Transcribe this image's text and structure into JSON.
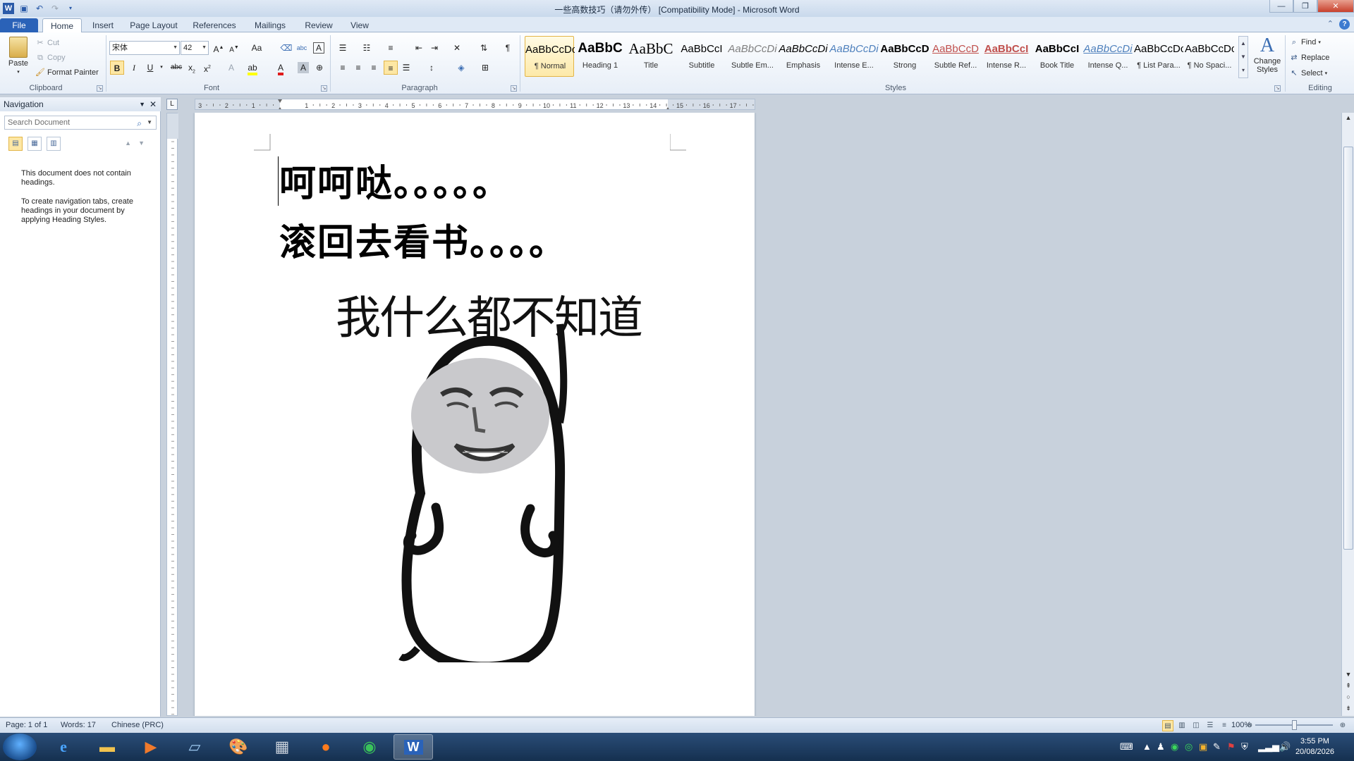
{
  "window": {
    "title": "一些高数技巧（请勿外传） [Compatibility Mode] - Microsoft Word"
  },
  "tabs": [
    "File",
    "Home",
    "Insert",
    "Page Layout",
    "References",
    "Mailings",
    "Review",
    "View"
  ],
  "clipboard": {
    "paste": "Paste",
    "cut": "Cut",
    "copy": "Copy",
    "format_painter": "Format Painter",
    "label": "Clipboard"
  },
  "font": {
    "name": "宋体",
    "size": "42",
    "label": "Font"
  },
  "paragraph": {
    "label": "Paragraph"
  },
  "styles": {
    "label": "Styles",
    "items": [
      {
        "sample": "AaBbCcDc",
        "name": "¶ Normal",
        "color": "#000000"
      },
      {
        "sample": "AaBbC",
        "name": "Heading 1",
        "color": "#000000"
      },
      {
        "sample": "AaBbC",
        "name": "Title",
        "color": "#000000"
      },
      {
        "sample": "AaBbCcI",
        "name": "Subtitle",
        "color": "#000000"
      },
      {
        "sample": "AaBbCcDi",
        "name": "Subtle Em...",
        "color": "#7f7f7f"
      },
      {
        "sample": "AaBbCcDi",
        "name": "Emphasis",
        "color": "#000000"
      },
      {
        "sample": "AaBbCcDi",
        "name": "Intense E...",
        "color": "#4f81bd"
      },
      {
        "sample": "AaBbCcD",
        "name": "Strong",
        "color": "#000000"
      },
      {
        "sample": "AaBbCcD",
        "name": "Subtle Ref...",
        "color": "#c0504d"
      },
      {
        "sample": "AaBbCcI",
        "name": "Intense R...",
        "color": "#c0504d"
      },
      {
        "sample": "AaBbCcI",
        "name": "Book Title",
        "color": "#000000"
      },
      {
        "sample": "AaBbCcDi",
        "name": "Intense Q...",
        "color": "#4f81bd"
      },
      {
        "sample": "AaBbCcDc",
        "name": "¶ List Para...",
        "color": "#000000"
      },
      {
        "sample": "AaBbCcDc",
        "name": "¶ No Spaci...",
        "color": "#000000"
      }
    ],
    "change_styles": "Change Styles"
  },
  "editing": {
    "find": "Find",
    "replace": "Replace",
    "select": "Select",
    "label": "Editing"
  },
  "navigation": {
    "title": "Navigation",
    "search_placeholder": "Search Document",
    "msg1": "This document does not contain headings.",
    "msg2": "To create navigation tabs, create headings in your document by applying Heading Styles."
  },
  "ruler_numbers": [
    "3",
    "2",
    "1",
    "1",
    "2",
    "3",
    "4",
    "5",
    "6",
    "7",
    "8",
    "9",
    "10",
    "11",
    "12",
    "13",
    "14",
    "15",
    "16",
    "17"
  ],
  "document": {
    "line1": "呵呵哒。。。。。",
    "line2": "滚回去看书。。。。",
    "meme_caption": "我什么都不知道"
  },
  "status": {
    "page": "Page: 1 of 1",
    "words": "Words: 17",
    "language": "Chinese (PRC)",
    "zoom": "100%"
  },
  "clock": {
    "time": "3:55 PM",
    "date": "20/08/2026"
  }
}
